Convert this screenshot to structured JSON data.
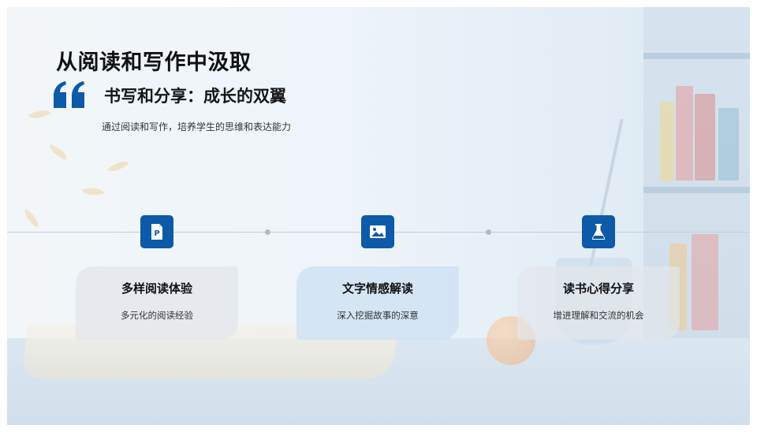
{
  "slide": {
    "title": "从阅读和写作中汲取",
    "subtitle": "书写和分享：成长的双翼",
    "description": "通过阅读和写作，培养学生的思维和表达能力"
  },
  "colors": {
    "accent": "#0c5aa8",
    "timeline": "#c7ced5",
    "card_grey": "#e2e6ea",
    "card_blue": "#cde2f2"
  },
  "timeline": {
    "items": [
      {
        "icon": "document-p-icon",
        "title": "多样阅读体验",
        "text": "多元化的阅读经验"
      },
      {
        "icon": "image-icon",
        "title": "文字情感解读",
        "text": "深入挖掘故事的深意"
      },
      {
        "icon": "flask-icon",
        "title": "读书心得分享",
        "text": "增进理解和交流的机会"
      }
    ]
  }
}
